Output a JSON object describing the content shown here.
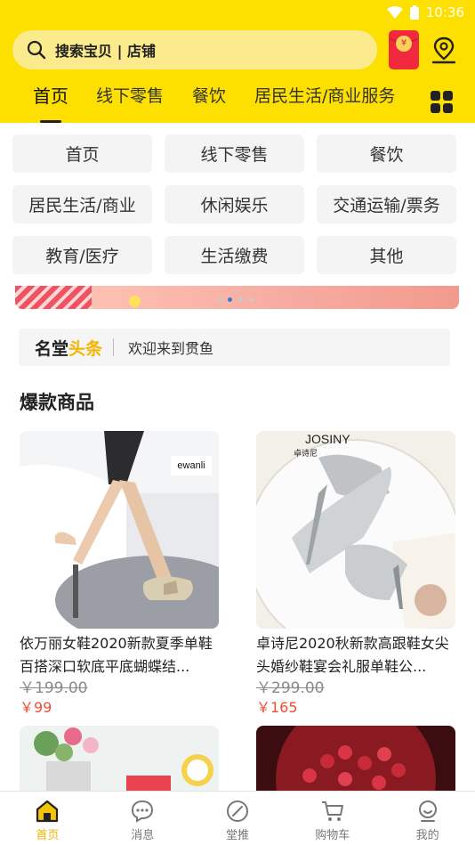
{
  "status_bar": {
    "time": "10:36"
  },
  "search": {
    "placeholder": "搜索宝贝 | 店铺"
  },
  "red_packet": {
    "symbol": "¥"
  },
  "tabs": [
    {
      "label": "首页",
      "active": true
    },
    {
      "label": "线下零售",
      "active": false
    },
    {
      "label": "餐饮",
      "active": false
    },
    {
      "label": "居民生活/商业服务",
      "active": false
    }
  ],
  "categories": [
    {
      "label": "首页"
    },
    {
      "label": "线下零售"
    },
    {
      "label": "餐饮"
    },
    {
      "label": "居民生活/商业"
    },
    {
      "label": "休闲娱乐"
    },
    {
      "label": "交通运输/票务"
    },
    {
      "label": "教育/医疗"
    },
    {
      "label": "生活缴费"
    },
    {
      "label": "其他"
    }
  ],
  "banner": {
    "active_dot": 1,
    "dot_count": 4
  },
  "headline": {
    "brand_prefix": "名堂",
    "brand_highlight": "头条",
    "message": "欢迎来到贯鱼"
  },
  "section": {
    "title": "爆款商品"
  },
  "products": [
    {
      "name": "依万丽女鞋2020新款夏季单鞋百搭深口软底平底蝴蝶结...",
      "old_price": "￥199.00",
      "price": "￥99",
      "brand_text": "ewanli"
    },
    {
      "name": "卓诗尼2020秋新款高跟鞋女尖头婚纱鞋宴会礼服单鞋公...",
      "old_price": "￥299.00",
      "price": "￥165",
      "brand_text": "JOSINY",
      "brand_sub": "卓诗尼"
    }
  ],
  "tabbar": [
    {
      "label": "首页",
      "icon": "home-icon",
      "active": true
    },
    {
      "label": "消息",
      "icon": "message-icon",
      "active": false
    },
    {
      "label": "堂推",
      "icon": "compass-icon",
      "active": false
    },
    {
      "label": "购物车",
      "icon": "cart-icon",
      "active": false
    },
    {
      "label": "我的",
      "icon": "profile-icon",
      "active": false
    }
  ],
  "colors": {
    "brand_yellow": "#fde000",
    "price_red": "#f24b34",
    "highlight": "#f5b400",
    "search_bg": "#fbeb8c"
  }
}
